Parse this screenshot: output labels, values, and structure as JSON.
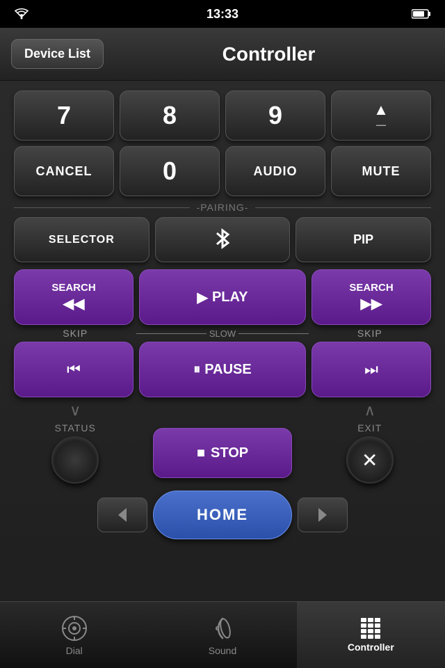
{
  "statusBar": {
    "time": "13:33",
    "wifiIcon": "wifi",
    "batteryIcon": "battery"
  },
  "header": {
    "deviceListLabel": "Device List",
    "title": "Controller"
  },
  "remote": {
    "numpad": {
      "buttons": [
        "7",
        "8",
        "9"
      ]
    },
    "volIcon": "▼",
    "cancelLabel": "CANCEL",
    "zeroLabel": "0",
    "audioLabel": "AUDIO",
    "muteLabel": "MUTE",
    "pairingLabel": "-PAIRING-",
    "selectorLabel": "SELECTOR",
    "btSymbol": "ʙ",
    "pipLabel": "PIP",
    "searchBackLabel": "SEARCH",
    "playLabel": "▶PLAY",
    "searchFwdLabel": "SEARCH",
    "skipLabel": "SKIP",
    "slowLabel": "SLOW",
    "skipLabel2": "SKIP",
    "skipBackLabel": "⏮",
    "pauseLabel": "⏸PAUSE",
    "skipFwdLabel": "⏭",
    "statusLabel": "STATUS",
    "stopLabel": "■STOP",
    "exitLabel": "EXIT",
    "homeLabel": "HOME"
  },
  "tabBar": {
    "tabs": [
      {
        "id": "dial",
        "label": "Dial",
        "active": false
      },
      {
        "id": "sound",
        "label": "Sound",
        "active": false
      },
      {
        "id": "controller",
        "label": "Controller",
        "active": true
      }
    ]
  }
}
